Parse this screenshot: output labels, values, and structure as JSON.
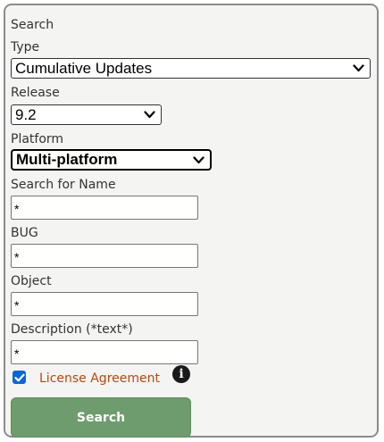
{
  "form": {
    "heading": "Search",
    "type": {
      "label": "Type",
      "value": "Cumulative Updates"
    },
    "release": {
      "label": "Release",
      "value": "9.2"
    },
    "platform": {
      "label": "Platform",
      "value": "Multi-platform"
    },
    "name": {
      "label": "Search for Name",
      "value": "*"
    },
    "bug": {
      "label": "BUG",
      "value": "*"
    },
    "object": {
      "label": "Object",
      "value": "*"
    },
    "description": {
      "label": "Description (*text*)",
      "value": "*"
    },
    "license": {
      "label": "License Agreement",
      "checked": true,
      "info_icon": "info-icon"
    },
    "submit_label": "Search"
  },
  "colors": {
    "panel_bg": "#f4f4f2",
    "panel_border": "#8c8c8c",
    "license_text": "#b34a12",
    "checkbox": "#0b66d6",
    "button_bg": "#6e9c6e"
  }
}
